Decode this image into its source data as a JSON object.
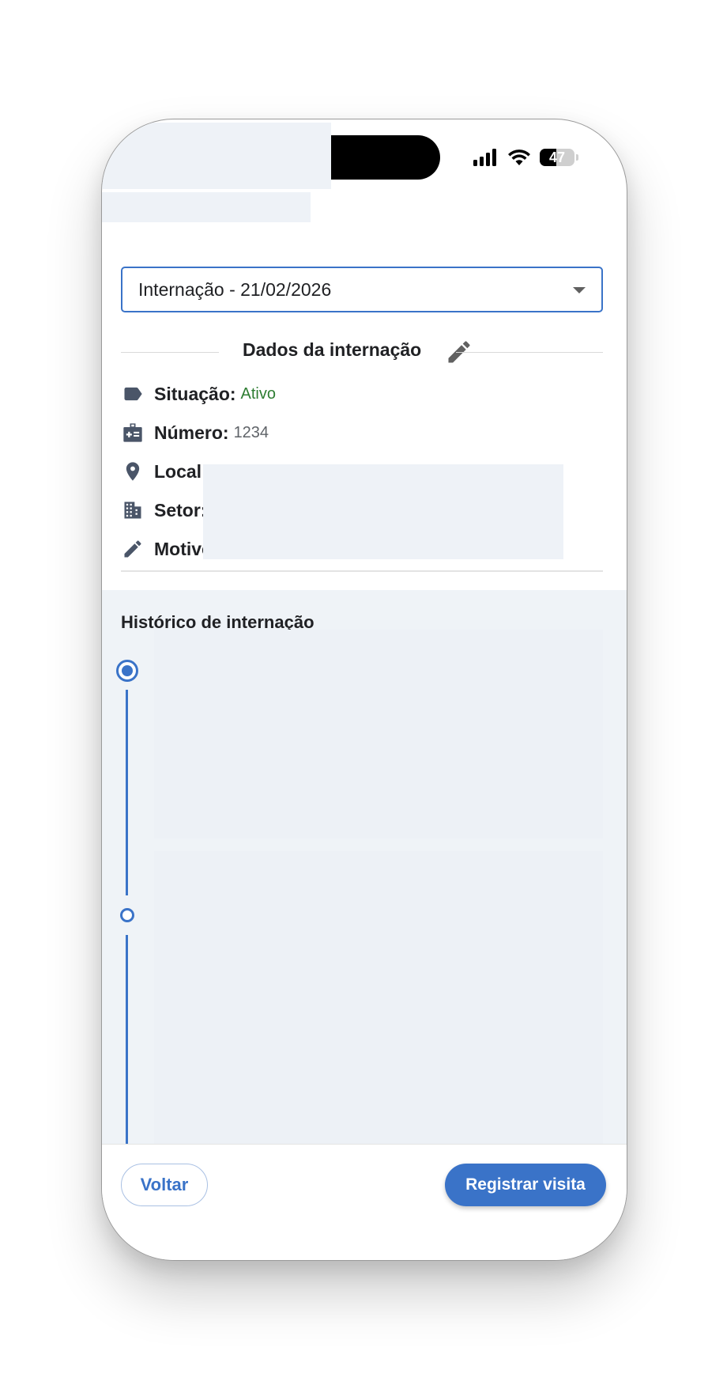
{
  "status_bar": {
    "battery_level": "47",
    "icons": [
      "signal-icon",
      "wifi-icon",
      "battery-icon"
    ]
  },
  "admission_select": {
    "value": "Internação - 21/02/2026"
  },
  "details_section": {
    "title": "Dados da internação",
    "rows": [
      {
        "icon": "label-icon",
        "label": "Situação:",
        "value": "Ativo",
        "value_color": "#2e7d32"
      },
      {
        "icon": "medical-id-icon",
        "label": "Número:",
        "value": "1234"
      },
      {
        "icon": "location-pin-icon",
        "label": "Local"
      },
      {
        "icon": "building-icon",
        "label": "Setor:"
      },
      {
        "icon": "pencil-icon",
        "label": "Motivo:"
      }
    ]
  },
  "history": {
    "title": "Histórico de internação"
  },
  "bottom_bar": {
    "back_label": "Voltar",
    "register_label": "Registrar visita"
  },
  "colors": {
    "accent": "#3a73c8",
    "history_bg": "#eff3f7",
    "active_green": "#2e7d32"
  }
}
